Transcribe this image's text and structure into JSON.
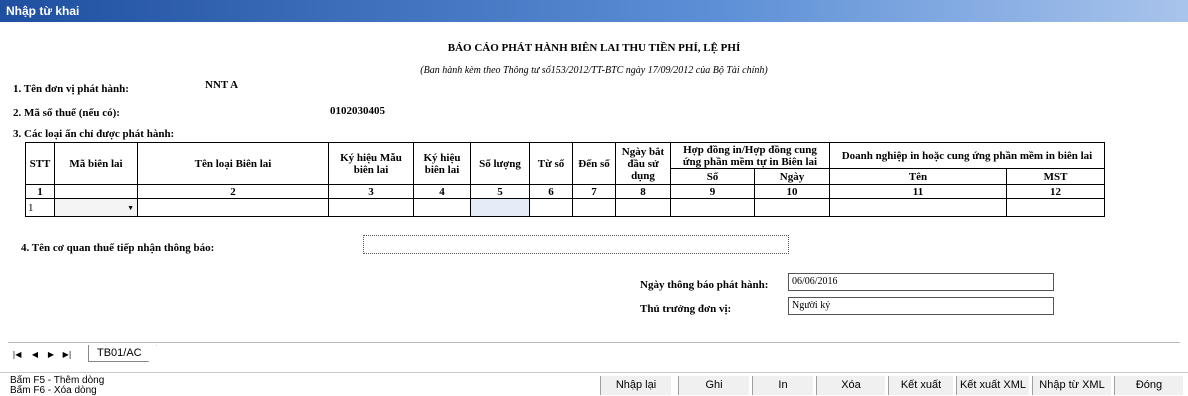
{
  "window": {
    "title": "Nhập từ khai"
  },
  "report": {
    "title": "BÁO CÁO PHÁT HÀNH BIÊN LAI THU TIỀN PHÍ, LỆ PHÍ",
    "subtitle": "(Ban hành kèm theo Thông tư số153/2012/TT-BTC ngày 17/09/2012 của Bộ Tài chính)",
    "unit_label": "1. Tên đơn vị phát hành:",
    "unit_value": "NNT A",
    "tax_label": "2. Mã số thuế (nếu có):",
    "tax_value": "0102030405",
    "types_label": "3. Các loại ấn chỉ được phát hành:",
    "agency_label": "4. Tên cơ quan thuế tiếp nhận thông báo:",
    "agency_value": "",
    "date_label": "Ngày thông báo phát hành:",
    "date_value": "06/06/2016",
    "head_label": "Thủ trưởng đơn vị:",
    "head_value": "Người ký"
  },
  "table": {
    "h_stt": "STT",
    "h_ma": "Mã biên lai",
    "h_ten": "Tên loại Biên lai",
    "h_mau": "Ký hiệu Mẫu biên lai",
    "h_kh": "Ký hiệu biên lai",
    "h_sl": "Số lượng",
    "h_tu": "Từ số",
    "h_den": "Đến số",
    "h_ngay": "Ngày bắt đầu sử dụng",
    "h_hd": "Hợp đồng in/Hợp đồng cung ứng phần mềm tự in Biên lai",
    "h_so": "Số",
    "h_ngay2": "Ngày",
    "h_dn": "Doanh nghiệp in hoặc cung ứng phần mềm in biên lai",
    "h_dnten": "Tên",
    "h_mst": "MST",
    "nums": [
      "1",
      "",
      "2",
      "3",
      "4",
      "5",
      "6",
      "7",
      "8",
      "9",
      "10",
      "11",
      "12"
    ],
    "row1_stt": "1"
  },
  "sheet": {
    "tab": "TB01/AC"
  },
  "footer": {
    "hint1": "Bấm F5 - Thêm dòng",
    "hint2": "Bấm F6 - Xóa dòng",
    "buttons": [
      "Nhập lại",
      "Ghi",
      "In",
      "Xóa",
      "Kết xuất",
      "Kết xuất XML",
      "Nhập từ XML",
      "Đóng"
    ]
  }
}
